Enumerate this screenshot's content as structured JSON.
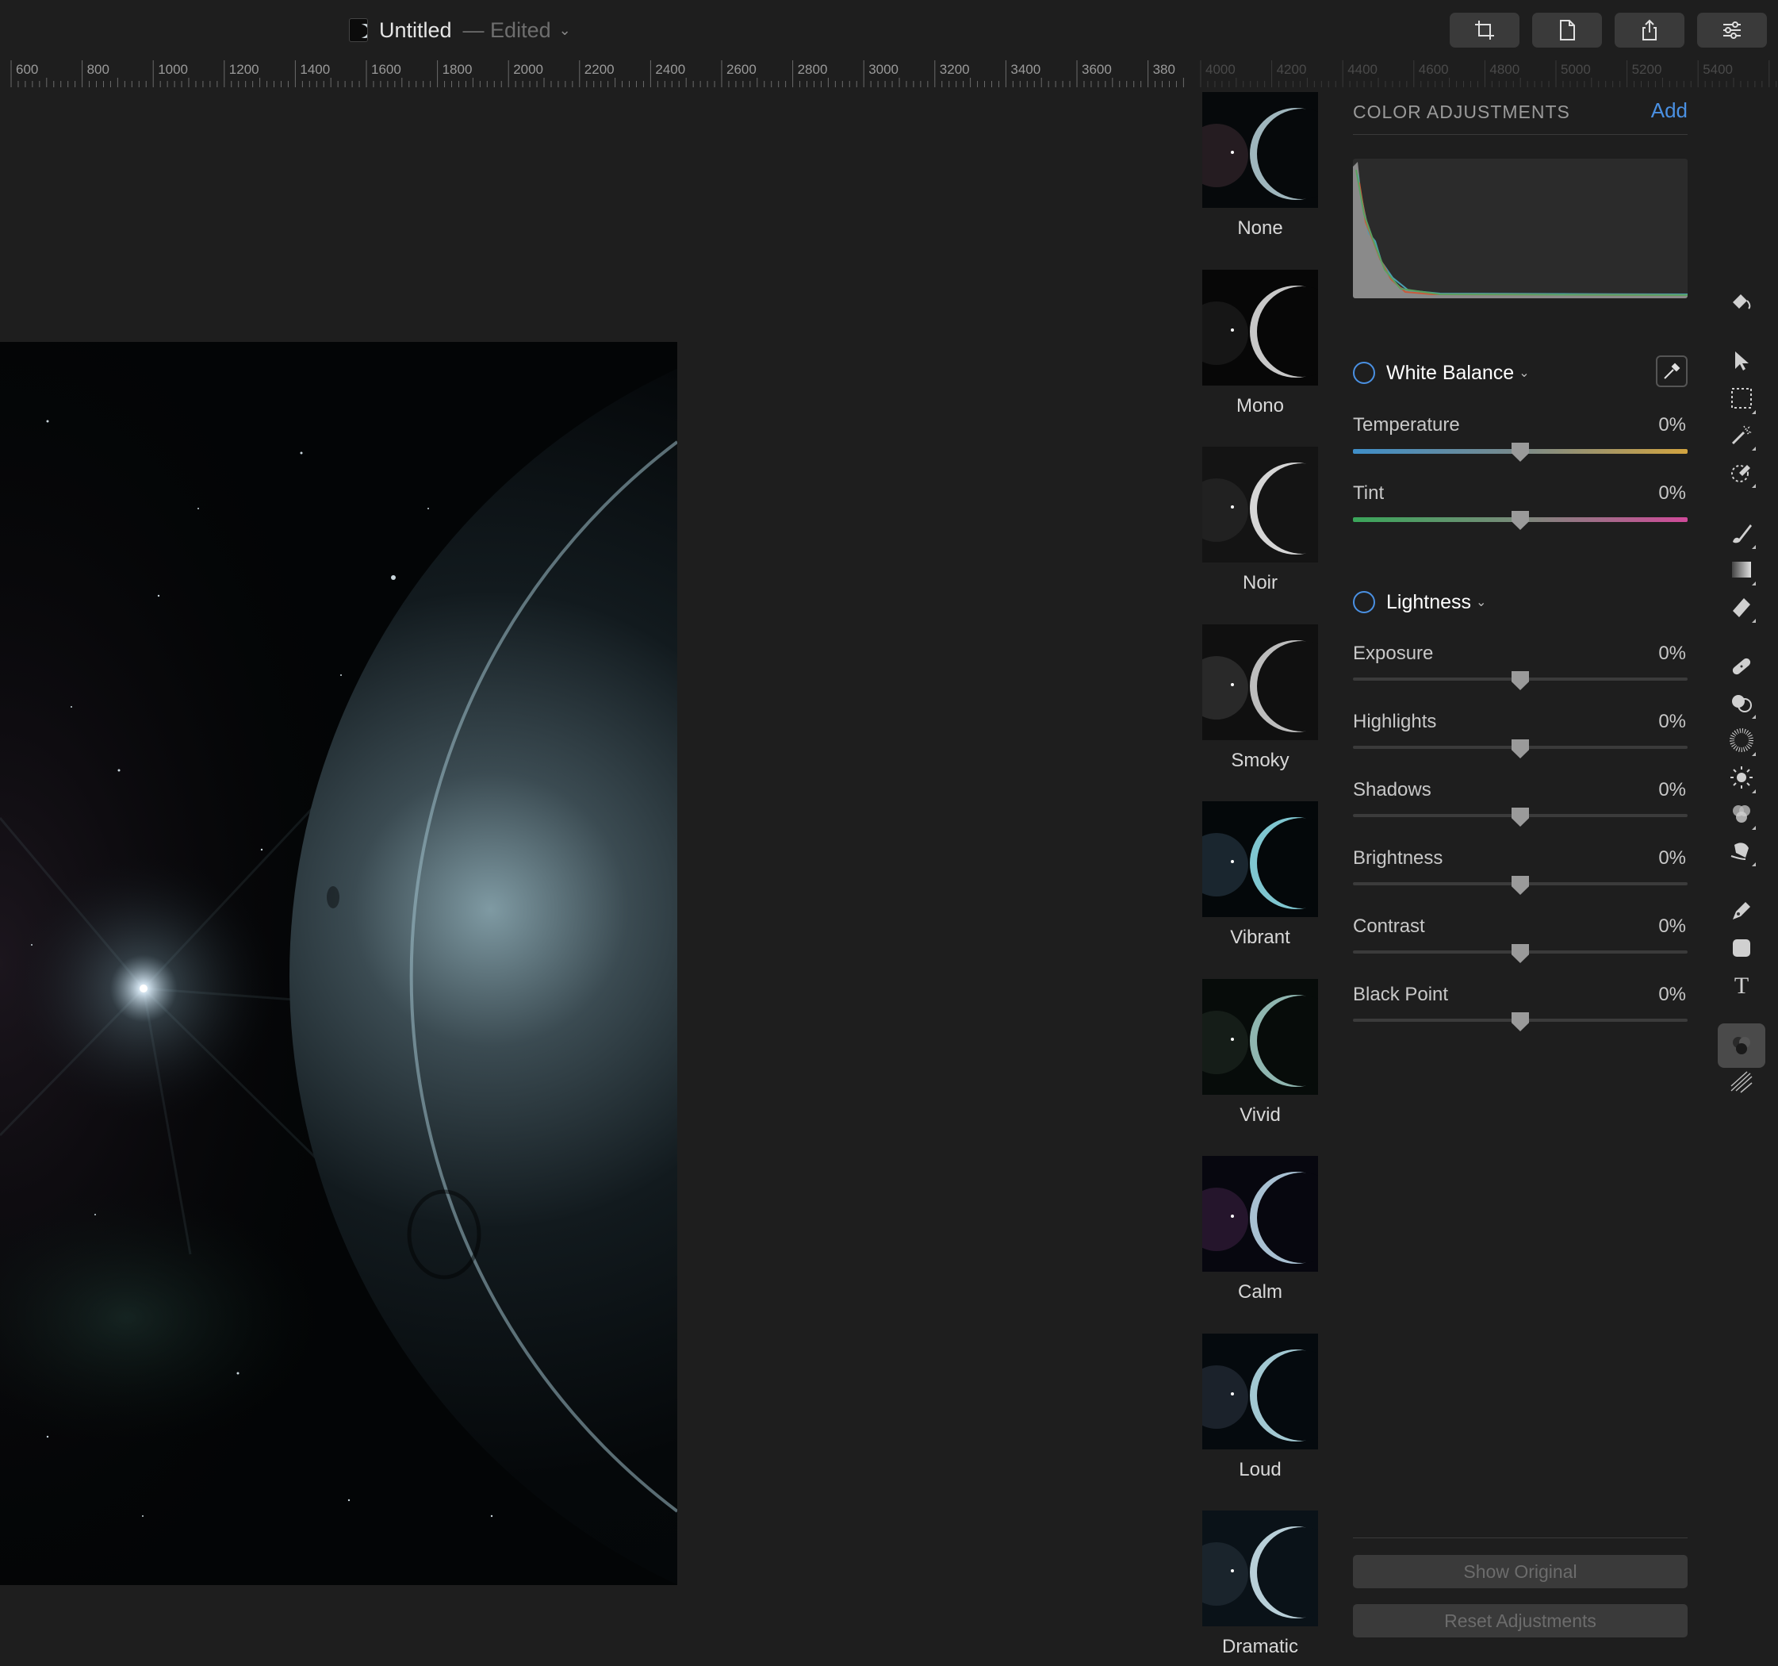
{
  "window": {
    "title": "Untitled",
    "edited_label": "— Edited",
    "toolbar_buttons": [
      {
        "name": "crop-icon"
      },
      {
        "name": "document-icon"
      },
      {
        "name": "share-icon"
      },
      {
        "name": "adjust-sliders-icon"
      }
    ]
  },
  "ruler": {
    "labels": [
      "600",
      "800",
      "1000",
      "1200",
      "1400",
      "1600",
      "1800",
      "2000",
      "2200",
      "2400",
      "2600",
      "2800",
      "3000",
      "3200",
      "3400",
      "3600",
      "380"
    ],
    "faded_labels": [
      "4000",
      "4200",
      "4400",
      "4600",
      "4800",
      "5000",
      "5200",
      "5400"
    ]
  },
  "presets": [
    {
      "label": "None"
    },
    {
      "label": "Mono"
    },
    {
      "label": "Noir"
    },
    {
      "label": "Smoky"
    },
    {
      "label": "Vibrant"
    },
    {
      "label": "Vivid"
    },
    {
      "label": "Calm"
    },
    {
      "label": "Loud"
    },
    {
      "label": "Dramatic"
    }
  ],
  "panel": {
    "title": "COLOR ADJUSTMENTS",
    "add_label": "Add",
    "white_balance": {
      "title": "White Balance",
      "sliders": [
        {
          "label": "Temperature",
          "value": "0%",
          "level": 0.5
        },
        {
          "label": "Tint",
          "value": "0%",
          "level": 0.5
        }
      ]
    },
    "lightness": {
      "title": "Lightness",
      "sliders": [
        {
          "label": "Exposure",
          "value": "0%",
          "level": 0.5
        },
        {
          "label": "Highlights",
          "value": "0%",
          "level": 0.5
        },
        {
          "label": "Shadows",
          "value": "0%",
          "level": 0.5
        },
        {
          "label": "Brightness",
          "value": "0%",
          "level": 0.5
        },
        {
          "label": "Contrast",
          "value": "0%",
          "level": 0.5
        },
        {
          "label": "Black Point",
          "value": "0%",
          "level": 0.5
        }
      ]
    },
    "show_original_label": "Show Original",
    "reset_label": "Reset Adjustments"
  },
  "tools": [
    {
      "name": "paint-bucket-icon"
    },
    {
      "name": "pointer-icon"
    },
    {
      "name": "marquee-selection-icon"
    },
    {
      "name": "magic-wand-icon"
    },
    {
      "name": "clone-stamp-icon"
    },
    {
      "name": "brush-icon"
    },
    {
      "name": "gradient-icon"
    },
    {
      "name": "eraser-icon"
    },
    {
      "name": "healing-bandage-icon"
    },
    {
      "name": "blend-icon"
    },
    {
      "name": "noise-icon"
    },
    {
      "name": "light-icon"
    },
    {
      "name": "color-adjustments-icon"
    },
    {
      "name": "smudge-icon"
    },
    {
      "name": "pen-icon"
    },
    {
      "name": "shape-icon"
    },
    {
      "name": "text-icon"
    },
    {
      "name": "color-adjustments-active-icon"
    },
    {
      "name": "effects-icon"
    }
  ],
  "colors": {
    "background": "#1e1e1e",
    "accent": "#4a90e2",
    "button": "#3a3a3a"
  }
}
